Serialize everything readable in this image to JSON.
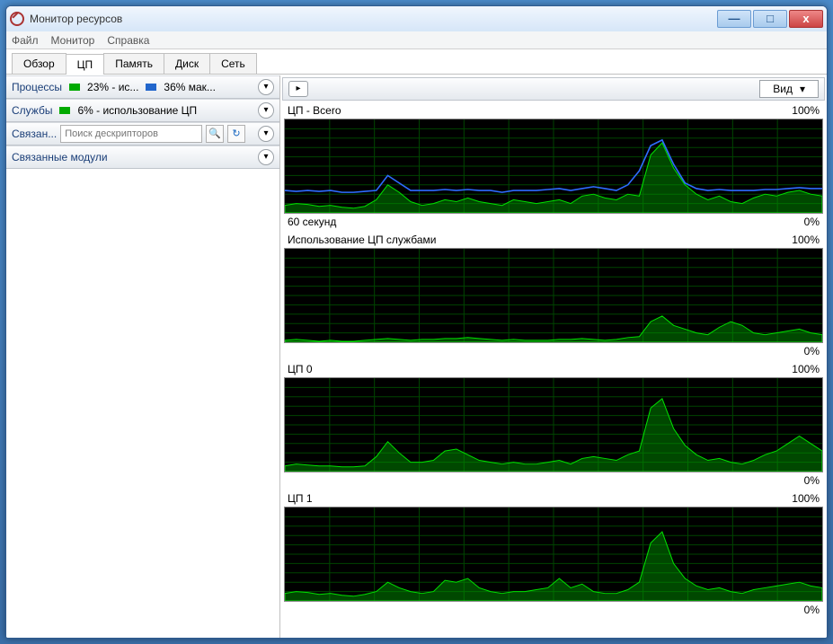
{
  "window": {
    "title": "Монитор ресурсов"
  },
  "menu": {
    "file": "Файл",
    "monitor": "Монитор",
    "help": "Справка"
  },
  "tabs": {
    "overview": "Обзор",
    "cpu": "ЦП",
    "memory": "Память",
    "disk": "Диск",
    "network": "Сеть"
  },
  "left": {
    "processes": {
      "label": "Процессы",
      "stat1": "23% - ис...",
      "stat2": "36% мак..."
    },
    "services": {
      "label": "Службы",
      "stat1": "6% - использование ЦП"
    },
    "handles": {
      "label": "Связан...",
      "placeholder": "Поиск дескрипторов"
    },
    "modules": {
      "label": "Связанные модули"
    }
  },
  "right": {
    "viewLabel": "Вид",
    "charts": [
      {
        "title": "ЦП - Bcero",
        "maxlabel": "100%",
        "minlabel": "0%",
        "xlabel_left": "60 секунд"
      },
      {
        "title": "Использование ЦП службами",
        "maxlabel": "100%",
        "minlabel": "0%"
      },
      {
        "title": "ЦП 0",
        "maxlabel": "100%",
        "minlabel": "0%"
      },
      {
        "title": "ЦП 1",
        "maxlabel": "100%",
        "minlabel": "0%"
      }
    ]
  },
  "chart_data": {
    "type": "line",
    "x_span_seconds": 60,
    "xlabel": "60 секунд",
    "ylabel": "%",
    "ylim": [
      0,
      100
    ],
    "series": [
      {
        "name": "ЦП - Bcero (green area)",
        "values": [
          8,
          10,
          9,
          7,
          8,
          6,
          5,
          7,
          14,
          30,
          22,
          12,
          8,
          10,
          14,
          12,
          16,
          12,
          10,
          8,
          14,
          12,
          10,
          12,
          14,
          10,
          18,
          20,
          16,
          14,
          20,
          18,
          62,
          75,
          48,
          30,
          20,
          14,
          18,
          12,
          10,
          16,
          20,
          18,
          22,
          24,
          20,
          18
        ],
        "color": "#00a000"
      },
      {
        "name": "ЦП - Bcero (blue max freq)",
        "values": [
          24,
          23,
          24,
          23,
          24,
          22,
          22,
          23,
          24,
          40,
          32,
          24,
          24,
          24,
          25,
          24,
          25,
          24,
          24,
          22,
          24,
          24,
          24,
          25,
          26,
          24,
          26,
          28,
          26,
          24,
          30,
          45,
          72,
          78,
          52,
          32,
          26,
          24,
          25,
          24,
          24,
          24,
          25,
          25,
          26,
          27,
          26,
          26
        ],
        "color": "#2e6cff"
      },
      {
        "name": "Использование ЦП службами",
        "values": [
          2,
          3,
          2,
          1,
          2,
          1,
          1,
          2,
          3,
          4,
          3,
          2,
          3,
          3,
          4,
          4,
          5,
          4,
          3,
          2,
          3,
          2,
          2,
          2,
          3,
          3,
          4,
          3,
          2,
          3,
          5,
          6,
          22,
          28,
          18,
          14,
          10,
          8,
          16,
          22,
          18,
          10,
          8,
          10,
          12,
          14,
          10,
          8
        ],
        "color": "#00a000"
      },
      {
        "name": "ЦП 0",
        "values": [
          6,
          8,
          7,
          6,
          6,
          5,
          5,
          6,
          16,
          32,
          20,
          10,
          10,
          12,
          22,
          24,
          18,
          12,
          10,
          8,
          10,
          8,
          8,
          10,
          12,
          8,
          14,
          16,
          14,
          12,
          18,
          22,
          68,
          78,
          46,
          28,
          18,
          12,
          14,
          10,
          8,
          12,
          18,
          22,
          30,
          38,
          30,
          22
        ],
        "color": "#00a000"
      },
      {
        "name": "ЦП 1",
        "values": [
          8,
          10,
          9,
          7,
          8,
          6,
          5,
          7,
          10,
          20,
          14,
          10,
          8,
          10,
          22,
          20,
          24,
          14,
          10,
          8,
          10,
          10,
          12,
          14,
          24,
          14,
          18,
          10,
          8,
          8,
          12,
          20,
          62,
          74,
          40,
          24,
          16,
          12,
          14,
          10,
          8,
          12,
          14,
          16,
          18,
          20,
          16,
          14
        ],
        "color": "#00a000"
      }
    ]
  }
}
